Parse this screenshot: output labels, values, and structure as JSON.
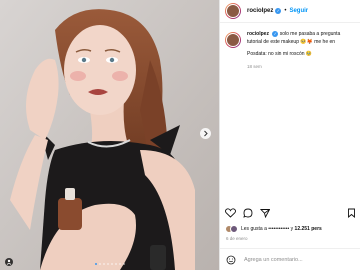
{
  "post": {
    "username": "rocioIpez",
    "follow_label": "Seguir",
    "separator": "•"
  },
  "caption": {
    "username": "rocioIpez",
    "line1": "solo me pasaba a pregunta",
    "line2": "tutorial de este makeup 🥺🦊 me he en",
    "line3": "Posdata: no sin mi roscón 🥹",
    "time": "18 sem"
  },
  "likes": {
    "prefix": "Les gusta a",
    "hidden_name": "••••••••••••",
    "middle": "y",
    "count": "12.251 pers"
  },
  "date": "6 de enero",
  "comment": {
    "placeholder": "Agrega un comentario..."
  },
  "carousel": {
    "total": 8,
    "current": 1
  },
  "colors": {
    "accent": "#0095f6",
    "verified": "#3897f0",
    "muted": "#8e8e8e"
  },
  "icons": [
    "heart-icon",
    "comment-icon",
    "share-icon",
    "bookmark-icon",
    "emoji-icon",
    "chevron-right-icon",
    "user-tag-icon",
    "verified-icon"
  ]
}
